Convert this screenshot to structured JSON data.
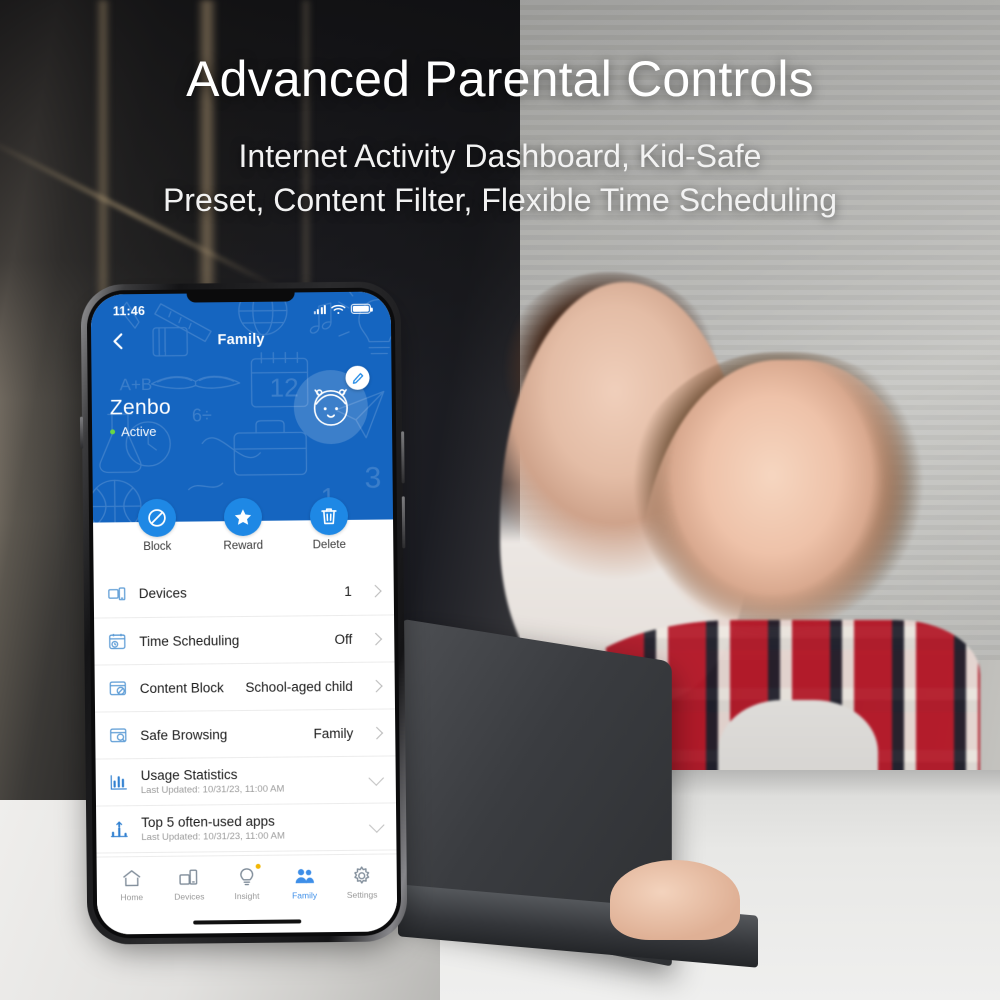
{
  "hero": {
    "title": "Advanced Parental Controls",
    "subtitle_line1": "Internet Activity Dashboard, Kid-Safe",
    "subtitle_line2": "Preset, Content Filter, Flexible Time Scheduling"
  },
  "phone": {
    "status_bar": {
      "time": "11:46",
      "signal_icon": "cellular-signal-icon",
      "wifi_icon": "wifi-icon",
      "battery_icon": "battery-icon"
    },
    "nav": {
      "back_icon": "chevron-left-icon",
      "title": "Family"
    },
    "profile": {
      "name": "Zenbo",
      "status": "Active",
      "status_color": "#6ddc3f",
      "avatar_icon": "child-face-avatar-icon",
      "edit_icon": "pencil-edit-icon"
    },
    "actions": [
      {
        "label": "Block",
        "icon": "block-circle-slash-icon"
      },
      {
        "label": "Reward",
        "icon": "star-icon"
      },
      {
        "label": "Delete",
        "icon": "trash-icon"
      }
    ],
    "list": [
      {
        "icon": "devices-icon",
        "label": "Devices",
        "value": "1",
        "accessory": "chevron"
      },
      {
        "icon": "calendar-clock-icon",
        "label": "Time Scheduling",
        "value": "Off",
        "accessory": "chevron"
      },
      {
        "icon": "content-block-icon",
        "label": "Content Block",
        "value": "School-aged child",
        "accessory": "chevron"
      },
      {
        "icon": "safe-browsing-icon",
        "label": "Safe Browsing",
        "value": "Family",
        "accessory": "chevron"
      }
    ],
    "expandables": [
      {
        "icon": "bar-chart-icon",
        "label": "Usage Statistics",
        "sub": "Last Updated: 10/31/23, 11:00 AM",
        "accessory": "chevron-down"
      },
      {
        "icon": "top-apps-icon",
        "label": "Top 5 often-used apps",
        "sub": "Last Updated: 10/31/23, 11:00 AM",
        "accessory": "chevron-down"
      }
    ],
    "tabs": [
      {
        "label": "Home",
        "icon": "home-icon",
        "active": false,
        "badge": false
      },
      {
        "label": "Devices",
        "icon": "devices-icon",
        "active": false,
        "badge": false
      },
      {
        "label": "Insight",
        "icon": "bulb-icon",
        "active": false,
        "badge": true
      },
      {
        "label": "Family",
        "icon": "family-icon",
        "active": true,
        "badge": false
      },
      {
        "label": "Settings",
        "icon": "gear-icon",
        "active": false,
        "badge": false
      }
    ],
    "colors": {
      "header_blue": "#1565c0",
      "accent_blue": "#1e88e5",
      "active_tab": "#3d8ee8",
      "status_green": "#6ddc3f",
      "badge_yellow": "#f2b705"
    }
  }
}
